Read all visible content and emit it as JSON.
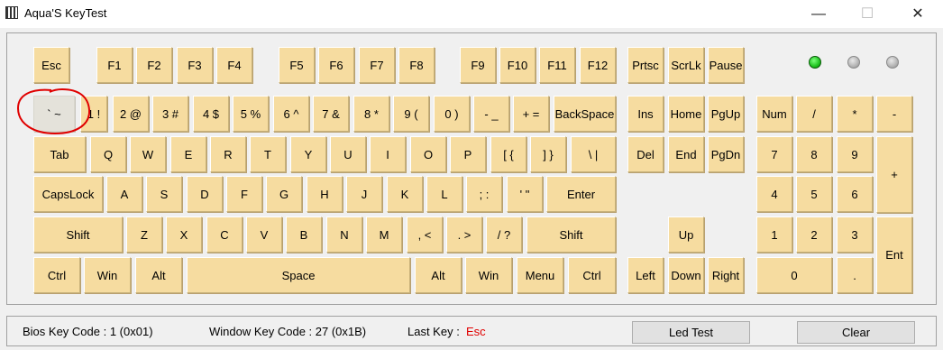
{
  "window": {
    "title": "Aqua'S KeyTest",
    "icon": "keyboard-icon",
    "controls": {
      "minimize": "—",
      "maximize": "☐",
      "close": "✕"
    }
  },
  "colors": {
    "key": "#f6dca0",
    "pressed_key": "#e4e2da",
    "led_on": "#1fc21f",
    "led_off": "#b4b4b4",
    "last_key": "#e00000",
    "annotation": "#e00000"
  },
  "leds": [
    {
      "name": "led-1",
      "state": "on"
    },
    {
      "name": "led-2",
      "state": "off"
    },
    {
      "name": "led-3",
      "state": "off"
    }
  ],
  "keyboard": {
    "function_row": {
      "esc": "Esc",
      "f1": "F1",
      "f2": "F2",
      "f3": "F3",
      "f4": "F4",
      "f5": "F5",
      "f6": "F6",
      "f7": "F7",
      "f8": "F8",
      "f9": "F9",
      "f10": "F10",
      "f11": "F11",
      "f12": "F12",
      "prtsc": "Prtsc",
      "scrlk": "ScrLk",
      "pause": "Pause"
    },
    "number_row": {
      "backtick": "` ~",
      "k1": "1 !",
      "k2": "2 @",
      "k3": "3 #",
      "k4": "4 $",
      "k5": "5 %",
      "k6": "6 ^",
      "k7": "7 &",
      "k8": "8 *",
      "k9": "9 (",
      "k0": "0 )",
      "minus": "- _",
      "equals": "+ =",
      "backspace": "BackSpace"
    },
    "tab_row": {
      "tab": "Tab",
      "q": "Q",
      "w": "W",
      "e": "E",
      "r": "R",
      "t": "T",
      "y": "Y",
      "u": "U",
      "i": "I",
      "o": "O",
      "p": "P",
      "lbracket": "[ {",
      "rbracket": "] }",
      "backslash": "\\ |"
    },
    "caps_row": {
      "capslock": "CapsLock",
      "a": "A",
      "s": "S",
      "d": "D",
      "f": "F",
      "g": "G",
      "h": "H",
      "j": "J",
      "k": "K",
      "l": "L",
      "semicolon": "; :",
      "quote": "' \"",
      "enter": "Enter"
    },
    "shift_row": {
      "lshift": "Shift",
      "z": "Z",
      "x": "X",
      "c": "C",
      "v": "V",
      "b": "B",
      "n": "N",
      "m": "M",
      "comma": ", <",
      "period": ". >",
      "slash": "/ ?",
      "rshift": "Shift"
    },
    "bottom_row": {
      "lctrl": "Ctrl",
      "lwin": "Win",
      "lalt": "Alt",
      "space": "Space",
      "ralt": "Alt",
      "rwin": "Win",
      "menu": "Menu",
      "rctrl": "Ctrl"
    },
    "nav": {
      "ins": "Ins",
      "home": "Home",
      "pgup": "PgUp",
      "del": "Del",
      "end": "End",
      "pgdn": "PgDn",
      "up": "Up",
      "left": "Left",
      "down": "Down",
      "right": "Right"
    },
    "numpad": {
      "num": "Num",
      "divide": "/",
      "multiply": "*",
      "minus": "-",
      "plus": "+",
      "n7": "7",
      "n8": "8",
      "n9": "9",
      "n4": "4",
      "n5": "5",
      "n6": "6",
      "n1": "1",
      "n2": "2",
      "n3": "3",
      "ent": "Ent",
      "n0": "0",
      "dot": "."
    },
    "pressed": "backtick"
  },
  "status_bar": {
    "bios_key_code": "Bios Key Code : 1 (0x01)",
    "window_key_code": "Window Key Code : 27 (0x1B)",
    "last_key_label": "Last Key :",
    "last_key_value": "Esc",
    "led_test_button": "Led Test",
    "clear_button": "Clear"
  }
}
